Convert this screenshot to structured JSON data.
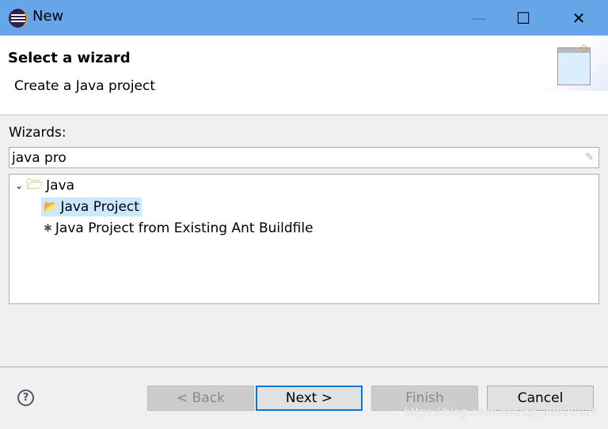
{
  "window": {
    "title": "New",
    "minimize": "—",
    "maximize": "☐",
    "close": "✕"
  },
  "header": {
    "title": "Select a wizard",
    "description": "Create a Java project"
  },
  "wizards": {
    "label": "Wizards:",
    "filter_value": "java pro",
    "clear_icon": "eraser-icon",
    "tree": [
      {
        "label": "Java",
        "expanded": true,
        "children": [
          {
            "label": "Java Project",
            "selected": true
          },
          {
            "label": "Java Project from Existing Ant Buildfile"
          }
        ]
      }
    ]
  },
  "buttons": {
    "help": "?",
    "back": "< Back",
    "next": "Next >",
    "finish": "Finish",
    "cancel": "Cancel"
  },
  "watermark": "https://blog.csdn.net/qq_29890029",
  "colors": {
    "titlebar": "#65a5e8",
    "selection": "#cce8ff",
    "default_button_border": "#0078d7"
  }
}
